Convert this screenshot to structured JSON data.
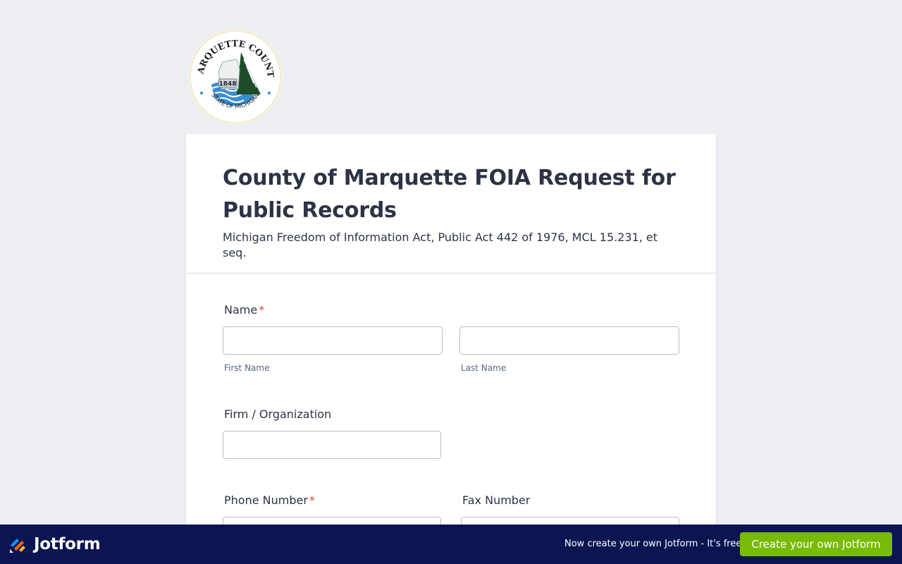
{
  "logo": {
    "top_text": "MARQUETTE COUNTY",
    "bottom_text": "STATE OF MICHIGAN",
    "year": "1848"
  },
  "form": {
    "title": "County of Marquette FOIA Request for Public Records",
    "subtitle": "Michigan Freedom of Information Act, Public Act 442 of 1976, MCL 15.231, et seq.",
    "fields": {
      "name": {
        "label": "Name",
        "required": "*",
        "first_sublabel": "First Name",
        "last_sublabel": "Last Name"
      },
      "firm": {
        "label": "Firm / Organization"
      },
      "phone": {
        "label": "Phone Number",
        "required": "*"
      },
      "fax": {
        "label": "Fax Number"
      }
    }
  },
  "promo": {
    "brand": "Jotform",
    "text": "Now create your own Jotform - It's free!",
    "button": "Create your own Jotform"
  },
  "colors": {
    "page_bg": "#eceef3",
    "promo_bg": "#0a1551",
    "button_green": "#78bb07",
    "required_red": "#f23a3c"
  }
}
